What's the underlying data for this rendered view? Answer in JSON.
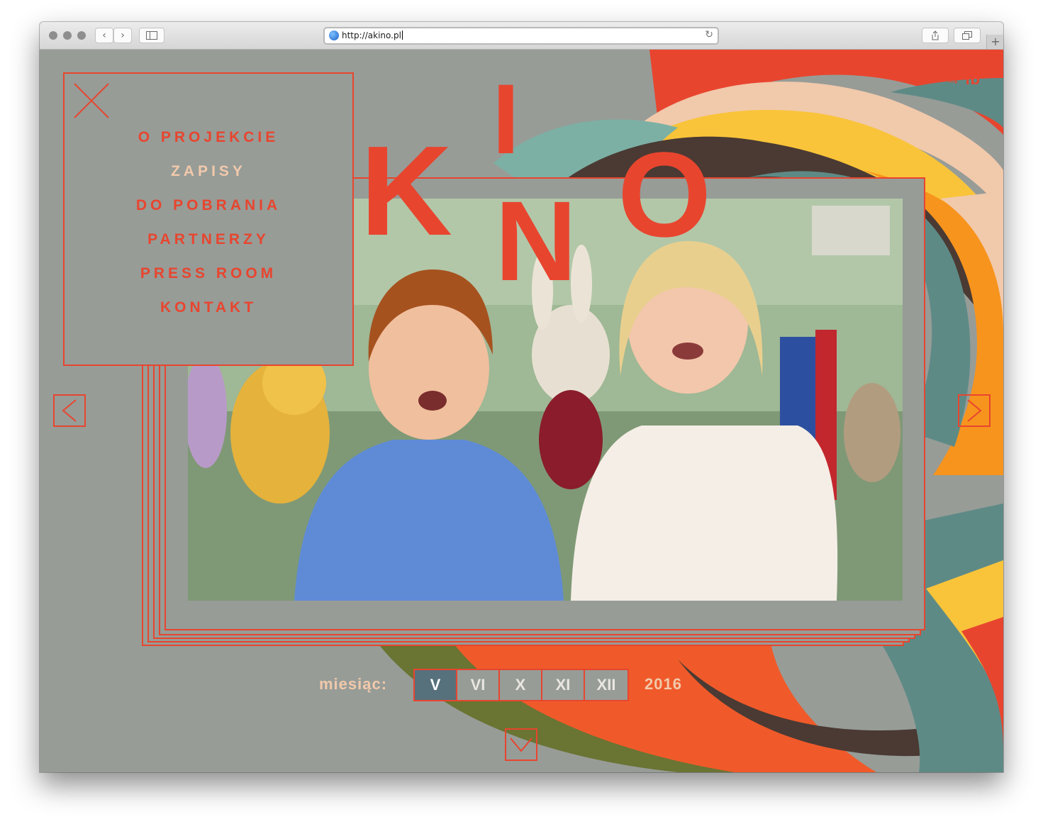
{
  "browser": {
    "url": "http://akino.pl",
    "icons": {
      "back": "chevron-left-icon",
      "forward": "chevron-right-icon",
      "sidebar": "sidebar-icon",
      "reload": "reload-icon",
      "share": "share-icon",
      "tabs": "tabs-icon",
      "new_tab": "plus-icon"
    }
  },
  "logo": {
    "letters": [
      "K",
      "I",
      "N",
      "O"
    ]
  },
  "menu": {
    "items": [
      {
        "label": "O PROJEKCIE",
        "active": false
      },
      {
        "label": "ZAPISY",
        "active": true
      },
      {
        "label": "DO POBRANIA",
        "active": false
      },
      {
        "label": "PARTNERZY",
        "active": false
      },
      {
        "label": "PRESS ROOM",
        "active": false
      },
      {
        "label": "KONTAKT",
        "active": false
      }
    ]
  },
  "social": {
    "fb_label": "→ fb"
  },
  "schedule": {
    "label": "miesiąc:",
    "months": [
      {
        "label": "V",
        "active": true
      },
      {
        "label": "VI",
        "active": false
      },
      {
        "label": "X",
        "active": false
      },
      {
        "label": "XI",
        "active": false
      },
      {
        "label": "XII",
        "active": false
      }
    ],
    "year": "2016"
  },
  "colors": {
    "accent": "#e8452f",
    "page_bg": "#979c97",
    "cream": "#f1c9ab",
    "active_month": "#56707c"
  }
}
